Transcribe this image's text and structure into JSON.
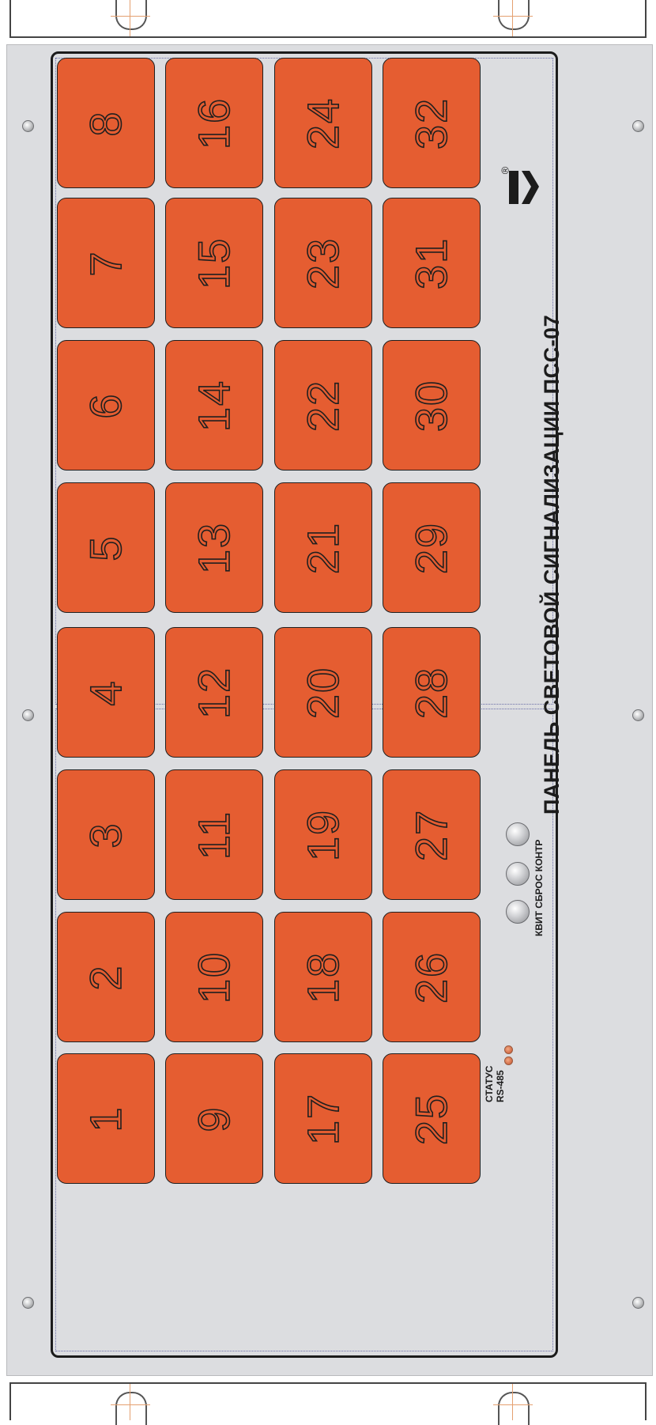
{
  "panel": {
    "title": "ПАНЕЛЬ СВЕТОВОЙ СИГНАЛИЗАЦИИ ПСС-07",
    "registered_mark": "®",
    "status_label_1": "СТАТУС",
    "status_label_2": "RS-485",
    "buttons_label": "КВИТ СБРОС КОНТР",
    "colors": {
      "cell": "#e55d31",
      "panel": "#dcdde0",
      "outline": "#1f1f1f"
    }
  },
  "cells": [
    "1",
    "2",
    "3",
    "4",
    "5",
    "6",
    "7",
    "8",
    "9",
    "10",
    "11",
    "12",
    "13",
    "14",
    "15",
    "16",
    "17",
    "18",
    "19",
    "20",
    "21",
    "22",
    "23",
    "24",
    "25",
    "26",
    "27",
    "28",
    "29",
    "30",
    "31",
    "32"
  ]
}
